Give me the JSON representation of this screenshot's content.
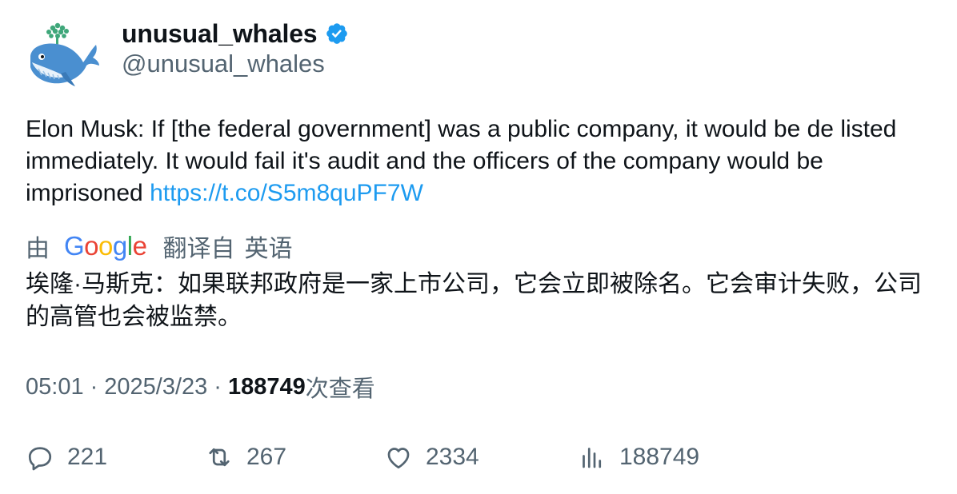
{
  "account": {
    "display_name": "unusual_whales",
    "handle": "@unusual_whales",
    "verified": true,
    "avatar_icon": "whale-logo-icon"
  },
  "tweet": {
    "text": "Elon Musk: If [the federal government] was a public company, it would be de listed immediately. It would fail it's audit and the officers of the company would be imprisoned ",
    "link": "https://t.co/S5m8quPF7W"
  },
  "translation": {
    "prefix": "由",
    "provider": "Google",
    "label": "翻译自",
    "source_language": "英语",
    "text": "埃隆·马斯克：如果联邦政府是一家上市公司，它会立即被除名。它会审计失败，公司的高管也会被监禁。"
  },
  "meta": {
    "time": "05:01",
    "separator": "·",
    "date": "2025/3/23",
    "views_count": "188749",
    "views_label": "次查看"
  },
  "actions": {
    "replies": "221",
    "retweets": "267",
    "likes": "2334",
    "views": "188749"
  },
  "colors": {
    "link": "#1d9bf0",
    "secondary_text": "#536471",
    "primary_text": "#0f1419",
    "verified_badge": "#1d9bf0"
  }
}
